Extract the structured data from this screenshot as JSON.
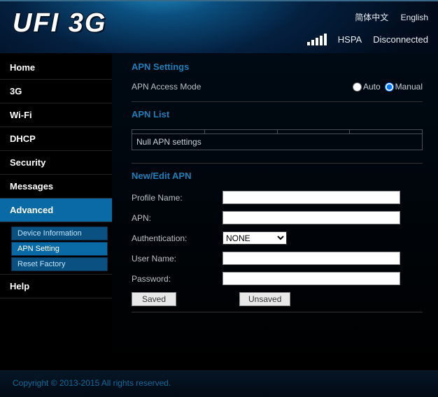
{
  "header": {
    "logo": "UFI 3G",
    "lang": {
      "zh": "简体中文",
      "en": "English"
    },
    "signal_bars": 5,
    "network": "HSPA",
    "connection": "Disconnected"
  },
  "nav": {
    "items": [
      {
        "label": "Home"
      },
      {
        "label": "3G"
      },
      {
        "label": "Wi-Fi"
      },
      {
        "label": "DHCP"
      },
      {
        "label": "Security"
      },
      {
        "label": "Messages"
      },
      {
        "label": "Advanced",
        "active": true
      }
    ],
    "sub": [
      {
        "label": "Device Information"
      },
      {
        "label": "APN Setting",
        "active": true
      },
      {
        "label": "Reset Factory"
      }
    ],
    "help": "Help"
  },
  "main": {
    "section1_title": "APN Settings",
    "access_mode_label": "APN Access Mode",
    "auto_label": "Auto",
    "manual_label": "Manual",
    "section2_title": "APN List",
    "list_row": "Null APN settings",
    "section3_title": "New/Edit APN",
    "profile_label": "Profile Name:",
    "apn_label": "APN:",
    "auth_label": "Authentication:",
    "auth_value": "NONE",
    "user_label": "User Name:",
    "pass_label": "Password:",
    "saved_btn": "Saved",
    "unsaved_btn": "Unsaved"
  },
  "footer": {
    "copyright": "Copyright © 2013-2015 All rights reserved."
  }
}
